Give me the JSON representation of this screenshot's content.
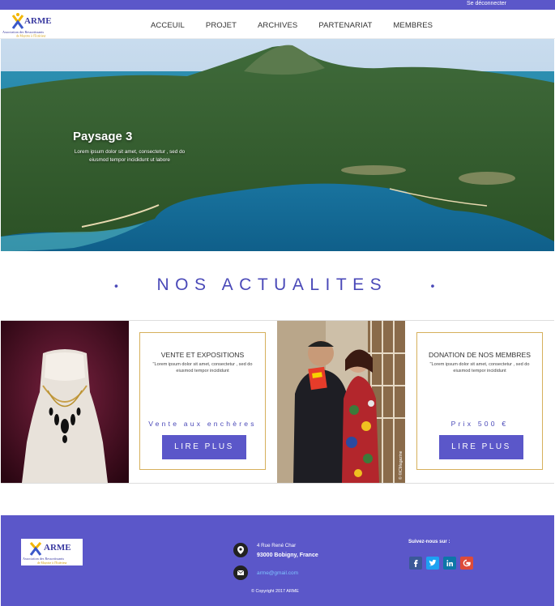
{
  "topbar": {
    "logout_label": "Se déconnecter"
  },
  "header": {
    "logo_text": "ARME",
    "logo_subtext": "Association des Ressortissants",
    "logo_subtext2": "de Mayotte à l'Extérieur",
    "nav": [
      "ACCEUIL",
      "PROJET",
      "ARCHIVES",
      "PARTENARIAT",
      "MEMBRES"
    ]
  },
  "hero": {
    "title": "Paysage 3",
    "subtitle": "Lorem ipsum dolor sit amet, consectetur , sed do eiusmod tempor incididunt ut labore"
  },
  "section": {
    "dot_left": "•",
    "title": "NOS ACTUALITES",
    "dot_right": "•"
  },
  "news": [
    {
      "title": "VENTE ET EXPOSITIONS",
      "desc": "\"Lorem ipsum dolor sit amet, consectetur , sed do eiusmod tempor incididunt",
      "tag": "Vente aux enchères",
      "button": "LIRE PLUS"
    },
    {
      "title": "DONATION DE NOS MEMBRES",
      "desc": "\"Lorem ipsum dolor sit amet, consectetur , sed do eiusmod tempor incididunt",
      "tag": "Prix 500 €",
      "button": "LIRE PLUS",
      "image_credit": "© ©ICMagazine"
    }
  ],
  "footer": {
    "address_line1": "4 Rue René Char",
    "address_line2": "93000 Bobigny, France",
    "email": "arme@gmail.com",
    "copyright": "© Copyright 2017 ARME",
    "follow_label": "Suivez-nous sur :",
    "social": [
      "facebook-icon",
      "twitter-icon",
      "linkedin-icon",
      "google-plus-icon"
    ]
  },
  "colors": {
    "primary": "#5b57c9",
    "accent_gold": "#d6b05c",
    "link": "#7fc3ff"
  }
}
